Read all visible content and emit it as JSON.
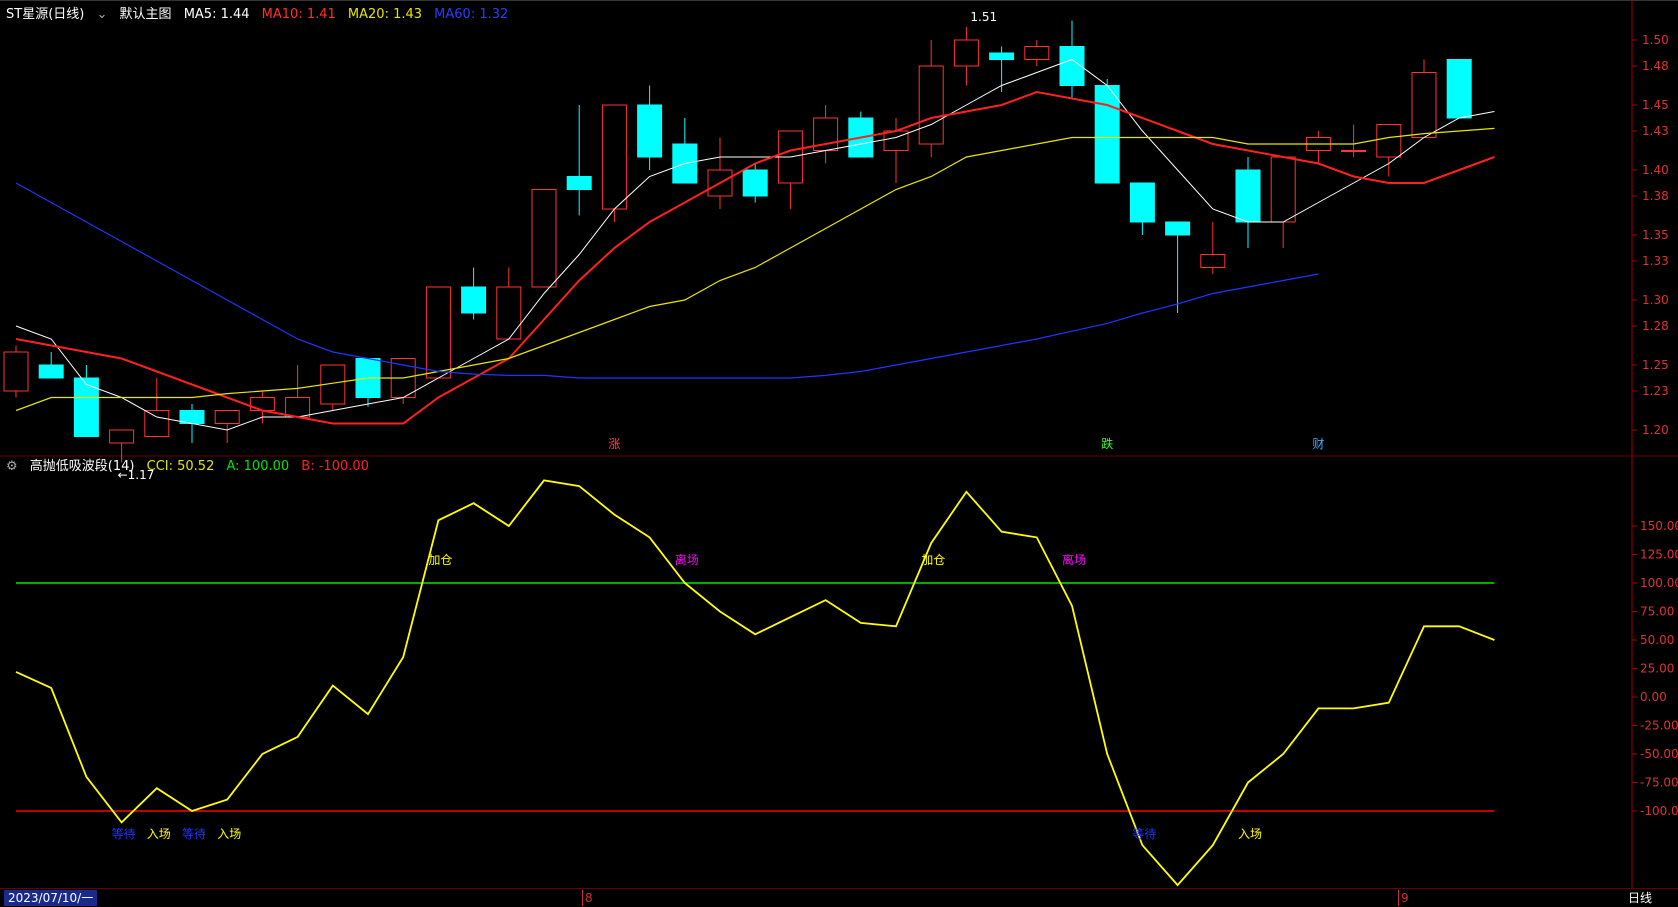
{
  "header": {
    "stock_name": "ST星源(日线)",
    "template_label": "默认主图",
    "ma5": "MA5: 1.44",
    "ma10": "MA10: 1.41",
    "ma20": "MA20: 1.43",
    "ma60": "MA60: 1.32"
  },
  "indicator_header": {
    "name": "高抛低吸波段(14)",
    "cci": "CCI: 50.52",
    "a": "A: 100.00",
    "b": "B: -100.00"
  },
  "bottom_bar": {
    "date_label": "2023/07/10/一",
    "month_8": "8",
    "month_9": "9",
    "period_button": "日线"
  },
  "colors": {
    "up": "#ff3333",
    "down": "#00ffff",
    "ma5": "#ffffff",
    "ma10": "#ff2020",
    "ma20": "#e6e600",
    "ma60": "#2233ff",
    "cci": "#ffff00",
    "a_line": "#00e600",
    "b_line": "#ff0000",
    "axis": "#a00000"
  },
  "chart_data": [
    {
      "type": "candlestick",
      "ylim": [
        1.18,
        1.515
      ],
      "yticks": [
        1.2,
        1.23,
        1.25,
        1.28,
        1.3,
        1.33,
        1.35,
        1.38,
        1.4,
        1.43,
        1.45,
        1.48,
        1.5
      ],
      "ytick_labels": [
        "1.20",
        "1.23",
        "1.25",
        "1.28",
        "1.30",
        "1.33",
        "1.35",
        "1.38",
        "1.40",
        "1.43",
        "1.45",
        "1.48",
        "1.50"
      ],
      "candles": [
        {
          "o": 1.23,
          "h": 1.265,
          "l": 1.225,
          "c": 1.26
        },
        {
          "o": 1.25,
          "h": 1.26,
          "l": 1.24,
          "c": 1.24
        },
        {
          "o": 1.24,
          "h": 1.25,
          "l": 1.195,
          "c": 1.195
        },
        {
          "o": 1.19,
          "h": 1.2,
          "l": 1.175,
          "c": 1.2
        },
        {
          "o": 1.195,
          "h": 1.24,
          "l": 1.195,
          "c": 1.215
        },
        {
          "o": 1.215,
          "h": 1.22,
          "l": 1.19,
          "c": 1.205
        },
        {
          "o": 1.205,
          "h": 1.215,
          "l": 1.19,
          "c": 1.215
        },
        {
          "o": 1.215,
          "h": 1.23,
          "l": 1.205,
          "c": 1.225
        },
        {
          "o": 1.21,
          "h": 1.25,
          "l": 1.21,
          "c": 1.225
        },
        {
          "o": 1.22,
          "h": 1.25,
          "l": 1.215,
          "c": 1.25
        },
        {
          "o": 1.255,
          "h": 1.255,
          "l": 1.218,
          "c": 1.225
        },
        {
          "o": 1.225,
          "h": 1.255,
          "l": 1.22,
          "c": 1.255
        },
        {
          "o": 1.24,
          "h": 1.31,
          "l": 1.24,
          "c": 1.31
        },
        {
          "o": 1.31,
          "h": 1.325,
          "l": 1.285,
          "c": 1.29
        },
        {
          "o": 1.27,
          "h": 1.325,
          "l": 1.27,
          "c": 1.31
        },
        {
          "o": 1.31,
          "h": 1.385,
          "l": 1.31,
          "c": 1.385
        },
        {
          "o": 1.395,
          "h": 1.45,
          "l": 1.365,
          "c": 1.385
        },
        {
          "o": 1.37,
          "h": 1.45,
          "l": 1.36,
          "c": 1.45
        },
        {
          "o": 1.45,
          "h": 1.465,
          "l": 1.4,
          "c": 1.41
        },
        {
          "o": 1.42,
          "h": 1.44,
          "l": 1.39,
          "c": 1.39
        },
        {
          "o": 1.38,
          "h": 1.425,
          "l": 1.37,
          "c": 1.4
        },
        {
          "o": 1.4,
          "h": 1.405,
          "l": 1.375,
          "c": 1.38
        },
        {
          "o": 1.39,
          "h": 1.43,
          "l": 1.37,
          "c": 1.43
        },
        {
          "o": 1.415,
          "h": 1.45,
          "l": 1.405,
          "c": 1.44
        },
        {
          "o": 1.44,
          "h": 1.445,
          "l": 1.41,
          "c": 1.41
        },
        {
          "o": 1.415,
          "h": 1.44,
          "l": 1.39,
          "c": 1.43
        },
        {
          "o": 1.42,
          "h": 1.5,
          "l": 1.41,
          "c": 1.48
        },
        {
          "o": 1.48,
          "h": 1.51,
          "l": 1.465,
          "c": 1.5
        },
        {
          "o": 1.49,
          "h": 1.495,
          "l": 1.46,
          "c": 1.485
        },
        {
          "o": 1.485,
          "h": 1.5,
          "l": 1.48,
          "c": 1.495
        },
        {
          "o": 1.495,
          "h": 1.515,
          "l": 1.455,
          "c": 1.465
        },
        {
          "o": 1.465,
          "h": 1.47,
          "l": 1.39,
          "c": 1.39
        },
        {
          "o": 1.39,
          "h": 1.39,
          "l": 1.35,
          "c": 1.36
        },
        {
          "o": 1.36,
          "h": 1.36,
          "l": 1.29,
          "c": 1.35
        },
        {
          "o": 1.325,
          "h": 1.36,
          "l": 1.32,
          "c": 1.335
        },
        {
          "o": 1.4,
          "h": 1.41,
          "l": 1.34,
          "c": 1.36
        },
        {
          "o": 1.36,
          "h": 1.41,
          "l": 1.34,
          "c": 1.41
        },
        {
          "o": 1.415,
          "h": 1.43,
          "l": 1.405,
          "c": 1.425
        },
        {
          "o": 1.415,
          "h": 1.435,
          "l": 1.41,
          "c": 1.415
        },
        {
          "o": 1.41,
          "h": 1.43,
          "l": 1.395,
          "c": 1.435
        },
        {
          "o": 1.425,
          "h": 1.485,
          "l": 1.425,
          "c": 1.475
        },
        {
          "o": 1.485,
          "h": 1.485,
          "l": 1.44,
          "c": 1.44
        }
      ],
      "series": [
        {
          "name": "MA5",
          "values": [
            1.28,
            1.27,
            1.235,
            1.225,
            1.21,
            1.205,
            1.2,
            1.21,
            1.21,
            1.215,
            1.22,
            1.225,
            1.24,
            1.255,
            1.27,
            1.305,
            1.335,
            1.37,
            1.395,
            1.405,
            1.41,
            1.41,
            1.41,
            1.415,
            1.42,
            1.425,
            1.435,
            1.45,
            1.465,
            1.475,
            1.485,
            1.465,
            1.43,
            1.4,
            1.37,
            1.36,
            1.36,
            1.375,
            1.39,
            1.405,
            1.425,
            1.44,
            1.445
          ]
        },
        {
          "name": "MA10",
          "values": [
            1.27,
            1.265,
            1.26,
            1.255,
            1.245,
            1.235,
            1.225,
            1.215,
            1.21,
            1.205,
            1.205,
            1.205,
            1.225,
            1.24,
            1.255,
            1.285,
            1.315,
            1.34,
            1.36,
            1.375,
            1.39,
            1.405,
            1.415,
            1.42,
            1.425,
            1.43,
            1.44,
            1.445,
            1.45,
            1.46,
            1.455,
            1.45,
            1.44,
            1.43,
            1.42,
            1.415,
            1.41,
            1.405,
            1.395,
            1.39,
            1.39,
            1.4,
            1.41
          ]
        },
        {
          "name": "MA20",
          "values": [
            1.215,
            1.225,
            1.225,
            1.225,
            1.225,
            1.225,
            1.228,
            1.23,
            1.232,
            1.236,
            1.24,
            1.24,
            1.245,
            1.25,
            1.255,
            1.265,
            1.275,
            1.285,
            1.295,
            1.3,
            1.315,
            1.325,
            1.34,
            1.355,
            1.37,
            1.385,
            1.395,
            1.41,
            1.415,
            1.42,
            1.425,
            1.425,
            1.425,
            1.425,
            1.425,
            1.42,
            1.42,
            1.42,
            1.42,
            1.425,
            1.428,
            1.43,
            1.432
          ]
        },
        {
          "name": "MA60",
          "values": [
            1.39,
            1.375,
            1.36,
            1.345,
            1.33,
            1.315,
            1.3,
            1.285,
            1.27,
            1.26,
            1.255,
            1.25,
            1.245,
            1.243,
            1.242,
            1.242,
            1.24,
            1.24,
            1.24,
            1.24,
            1.24,
            1.24,
            1.24,
            1.242,
            1.245,
            1.25,
            1.255,
            1.26,
            1.265,
            1.27,
            1.276,
            1.282,
            1.29,
            1.297,
            1.305,
            1.31,
            1.315,
            1.32
          ]
        }
      ],
      "annotations": [
        {
          "text": "←1.17",
          "index": 3,
          "value": 1.17
        },
        {
          "text": "1.51",
          "index": 27,
          "value": 1.51
        }
      ],
      "event_markers": [
        {
          "text": "涨",
          "index": 17
        },
        {
          "text": "跌",
          "index": 31
        },
        {
          "text": "财",
          "index": 37
        }
      ]
    },
    {
      "type": "line",
      "title": "高抛低吸波段(14)",
      "ylim": [
        -165,
        195
      ],
      "yticks": [
        150,
        125,
        100,
        75,
        50,
        25,
        0,
        -25,
        -50,
        -75,
        -100
      ],
      "ytick_labels": [
        "150.00",
        "125.00",
        "100.00",
        "75.00",
        "50.00",
        "25.00",
        "0.00",
        "-25.00",
        "-50.00",
        "-75.00",
        "-100.00"
      ],
      "series": [
        {
          "name": "CCI",
          "values": [
            22,
            8,
            -70,
            -110,
            -80,
            -100,
            -90,
            -50,
            -35,
            10,
            -15,
            35,
            155,
            170,
            150,
            190,
            185,
            160,
            140,
            100,
            75,
            55,
            70,
            85,
            65,
            62,
            135,
            180,
            145,
            140,
            80,
            -50,
            -130,
            -165,
            -130,
            -75,
            -50,
            -10,
            -10,
            -5,
            62,
            62,
            50
          ]
        },
        {
          "name": "A",
          "values": [
            100
          ]
        },
        {
          "name": "B",
          "values": [
            -100
          ]
        }
      ],
      "labels": [
        {
          "text": "等待",
          "index": 3,
          "value": -120,
          "color": "#2233ff"
        },
        {
          "text": "入场",
          "index": 4,
          "value": -120,
          "color": "#ffff00"
        },
        {
          "text": "等待",
          "index": 5,
          "value": -120,
          "color": "#2233ff"
        },
        {
          "text": "入场",
          "index": 6,
          "value": -120,
          "color": "#ffff00"
        },
        {
          "text": "加仓",
          "index": 12,
          "value": 120,
          "color": "#ffff00"
        },
        {
          "text": "离场",
          "index": 19,
          "value": 120,
          "color": "#ff00ff"
        },
        {
          "text": "加仓",
          "index": 26,
          "value": 120,
          "color": "#ffff00"
        },
        {
          "text": "离场",
          "index": 30,
          "value": 120,
          "color": "#ff00ff"
        },
        {
          "text": "等待",
          "index": 32,
          "value": -120,
          "color": "#2233ff"
        },
        {
          "text": "入场",
          "index": 35,
          "value": -120,
          "color": "#ffff00"
        }
      ]
    }
  ]
}
